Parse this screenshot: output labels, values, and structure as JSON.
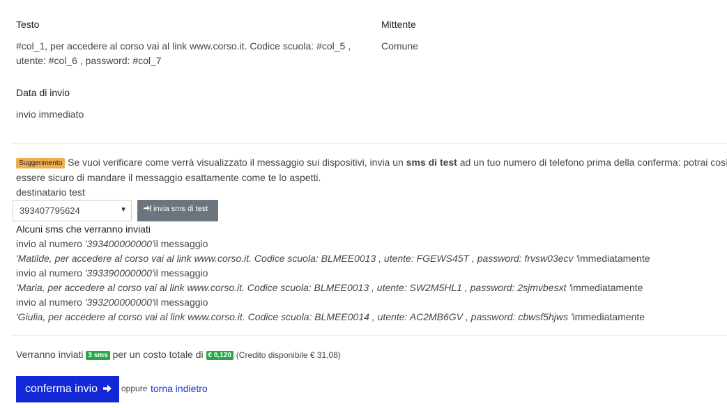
{
  "details": {
    "testo_label": "Testo",
    "testo_line1": "#col_1, per accedere al corso vai al link www.corso.it. Codice scuola: #col_5 ,",
    "testo_line2": "utente: #col_6 , password: #col_7",
    "mittente_label": "Mittente",
    "mittente_value": "Comune",
    "data_label": "Data di invio",
    "data_value": "invio immediato"
  },
  "suggestion": {
    "badge": "Suggerimento",
    "text_before": "Se vuoi verificare come verrà visualizzato il messaggio sui dispositivi, invia un",
    "bold": "sms di test",
    "text_after": "ad un tuo numero di telefono prima della conferma: potrai così",
    "line2": "essere sicuro di mandare il messaggio esattamente come te lo aspetti."
  },
  "test": {
    "label": "destinatario test",
    "selected": "393407795624",
    "button_label": "invia sms di test"
  },
  "preview": {
    "heading": "Alcuni sms che verranno inviati",
    "prefix": "invio al numero",
    "suffix": "il messaggio",
    "when": "immediatamente",
    "items": [
      {
        "number": "'393400000000'",
        "message": "'Matilde, per accedere al corso vai al link www.corso.it. Codice scuola: BLMEE0013 , utente: FGEWS45T , password: frvsw03ecv '"
      },
      {
        "number": "'393390000000'",
        "message": "'Maria, per accedere al corso vai al link www.corso.it. Codice scuola: BLMEE0013 , utente: SW2M5HL1 , password: 2sjmvbesxt '"
      },
      {
        "number": "'393200000000'",
        "message": "'Giulia, per accedere al corso vai al link www.corso.it. Codice scuola: BLMEE0014 , utente: AC2MB6GV , password: cbwsf5hjws '"
      }
    ]
  },
  "summary": {
    "text1": "Verranno inviati",
    "count_badge": "3 sms",
    "text2": "per un costo totale di",
    "cost_badge": "€ 0,120",
    "credit": "(Credito disponibile € 31,08)"
  },
  "actions": {
    "confirm_label": "conferma invio",
    "oppure": "oppure",
    "back_link": "torna indietro"
  },
  "colors": {
    "primary": "#1227d6",
    "warning": "#f0ad4e",
    "success": "#28a745",
    "secondary": "#6c757d",
    "link": "#1a3ad8"
  }
}
